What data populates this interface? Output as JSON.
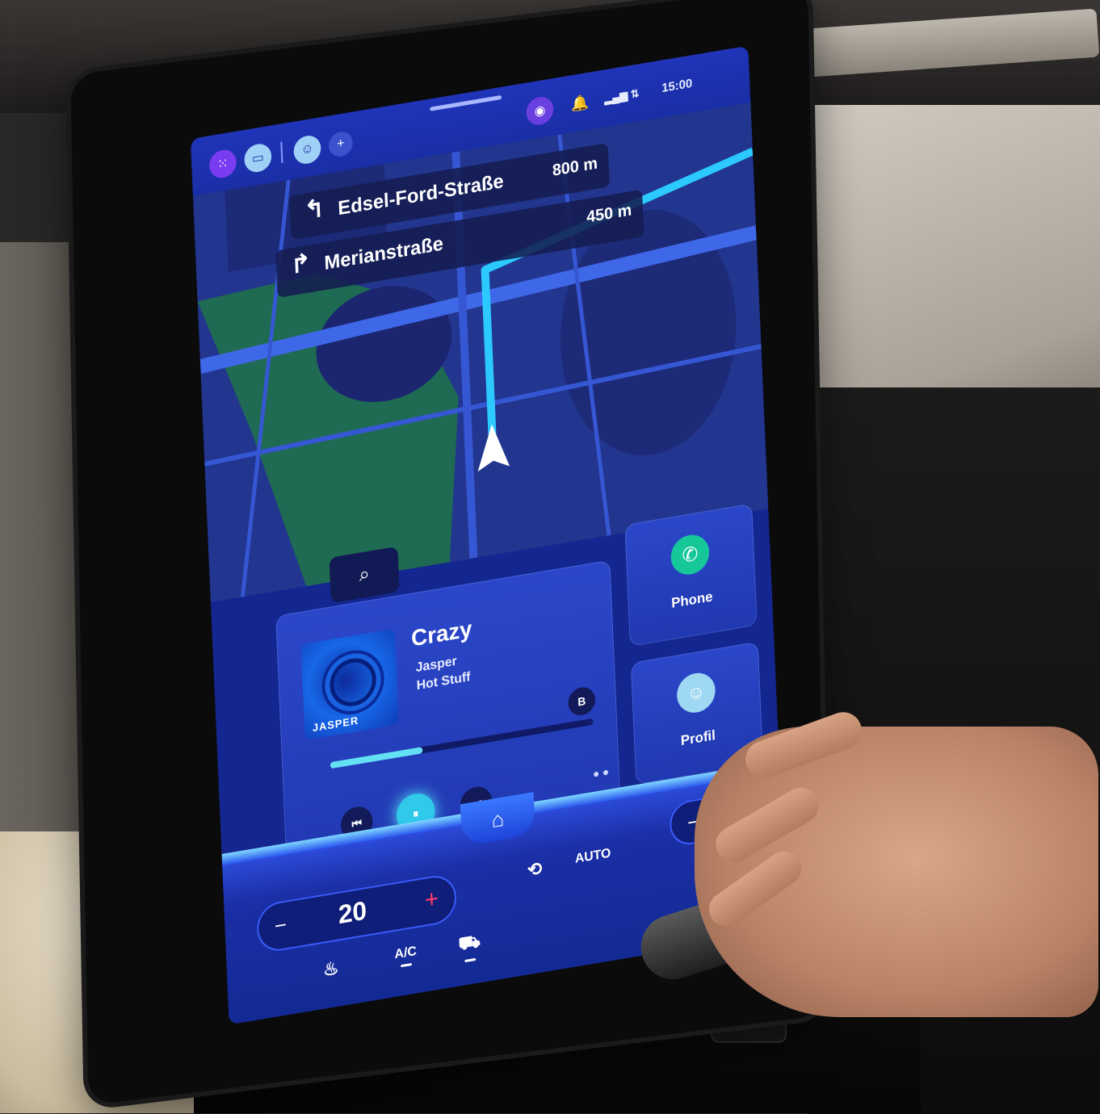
{
  "status_bar": {
    "time": "15:00",
    "icons": [
      "apps-icon",
      "camera-icon",
      "profile-icon",
      "add-icon",
      "media-icon",
      "bell-icon",
      "signal-icon"
    ]
  },
  "navigation": {
    "next_turn": {
      "street": "Edsel-Ford-Straße",
      "distance": "800 m",
      "direction": "left"
    },
    "current_turn": {
      "street": "Merianstraße",
      "distance": "450 m",
      "direction": "right"
    }
  },
  "media": {
    "title": "Crazy",
    "artist": "Jasper",
    "album": "Hot Stuff",
    "album_art_text": "JASPER",
    "progress": 0.35
  },
  "tiles": {
    "phone_label": "Phone",
    "profile_label": "Profil"
  },
  "climate": {
    "temperature": "20",
    "ac_label": "A/C",
    "auto_label": "AUTO",
    "minus": "−",
    "plus": "+"
  },
  "colors": {
    "accent": "#30c9ea",
    "phone_green": "#16c79a",
    "temp_plus_red": "#ff3a68",
    "screen_blue": "#1a2ea6"
  }
}
